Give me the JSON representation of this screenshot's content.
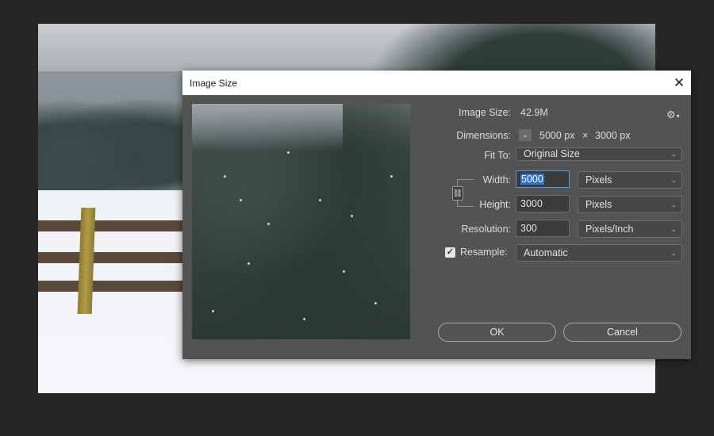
{
  "dialog": {
    "title": "Image Size",
    "close_symbol": "✕",
    "image_size_label": "Image Size:",
    "image_size_value": "42.9M",
    "gear_icon": "gear-icon",
    "dimensions_label": "Dimensions:",
    "dimensions_width": "5000 px",
    "dimensions_times": "×",
    "dimensions_height": "3000 px",
    "fit_to_label": "Fit To:",
    "fit_to_value": "Original Size",
    "width_label": "Width:",
    "width_value": "5000",
    "width_unit": "Pixels",
    "height_label": "Height:",
    "height_value": "3000",
    "height_unit": "Pixels",
    "resolution_label": "Resolution:",
    "resolution_value": "300",
    "resolution_unit": "Pixels/Inch",
    "resample_label": "Resample:",
    "resample_checked": true,
    "resample_value": "Automatic",
    "ok_label": "OK",
    "cancel_label": "Cancel"
  },
  "colors": {
    "dialog_bg": "#535353",
    "app_bg": "#262626",
    "focus_accent": "#4b9fe8",
    "selection": "#2f73c8"
  }
}
